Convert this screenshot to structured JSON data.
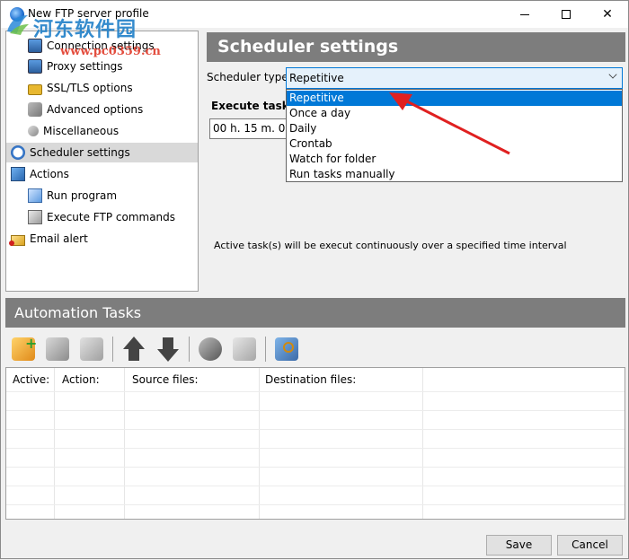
{
  "window": {
    "title": "New FTP server profile"
  },
  "watermark": {
    "line1": "河东软件园",
    "line2": "www.pc0359.cn"
  },
  "tree": {
    "items": [
      {
        "label": "Connection settings",
        "icon": "connection-icon"
      },
      {
        "label": "Proxy settings",
        "icon": "proxy-icon"
      },
      {
        "label": "SSL/TLS options",
        "icon": "lock-icon"
      },
      {
        "label": "Advanced options",
        "icon": "advanced-icon"
      },
      {
        "label": "Miscellaneous",
        "icon": "misc-icon"
      },
      {
        "label": "Scheduler settings",
        "icon": "clock-icon",
        "selected": true
      },
      {
        "label": "Actions",
        "icon": "actions-icon"
      },
      {
        "label": "Run program",
        "icon": "run-program-icon"
      },
      {
        "label": "Execute FTP commands",
        "icon": "ftp-commands-icon"
      },
      {
        "label": "Email alert",
        "icon": "email-icon"
      }
    ]
  },
  "scheduler": {
    "header": "Scheduler settings",
    "type_label": "Scheduler type:",
    "type_value": "Repetitive",
    "options": [
      "Repetitive",
      "Once a day",
      "Daily",
      "Crontab",
      "Watch for folder",
      "Run tasks manually"
    ],
    "highlighted_option": "Repetitive",
    "execute_label": "Execute task(s",
    "interval_value": "00 h. 15 m. 00",
    "info": "Active task(s) will be execut continuously over a specified time interval"
  },
  "automation": {
    "header": "Automation Tasks",
    "toolbar_icons": [
      "add-task-icon",
      "edit-task-icon",
      "delete-task-icon",
      "move-up-icon",
      "move-down-icon",
      "refresh-task-icon",
      "copy-task-icon",
      "search-task-icon"
    ],
    "columns": [
      "Active:",
      "Action:",
      "Source files:",
      "Destination files:"
    ],
    "rows": []
  },
  "buttons": {
    "save": "Save",
    "cancel": "Cancel"
  },
  "colors": {
    "header_bg": "#7d7d7d",
    "selection_blue": "#0078d7",
    "annotation_red": "#e02020"
  }
}
